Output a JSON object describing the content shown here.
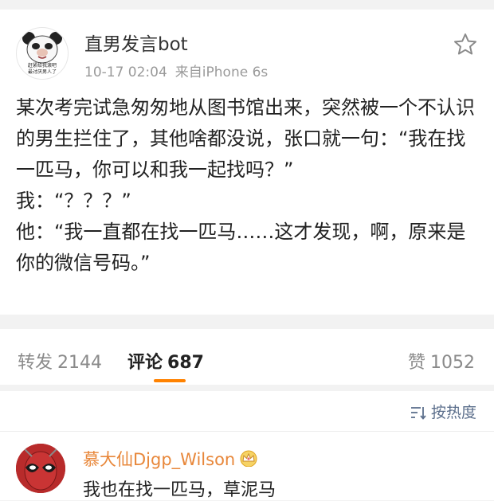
{
  "post": {
    "username": "直男发言bot",
    "time": "10-17 02:04",
    "source": "来自iPhone 6s",
    "avatar_caption_line1": "赶紧给我滚吧",
    "avatar_caption_line2": "最讨厌男人了",
    "lines": [
      "某次考完试急匆匆地从图书馆出来，突然被一个不认识的男生拦住了，其他啥都没说，张口就一句：“我在找一匹马，你可以和我一起找吗？”",
      "我：“？？？”",
      "他：“我一直都在找一匹马……这才发现，啊，原来是你的微信号码。”"
    ]
  },
  "stats": {
    "repost_label": "转发",
    "repost_count": "2144",
    "comment_label": "评论",
    "comment_count": "687",
    "like_label": "赞",
    "like_count": "1052"
  },
  "comments": {
    "sort_label": "按热度",
    "items": [
      {
        "username": "慕大仙Djgp_Wilson",
        "text": "我也在找一匹马，草泥马"
      }
    ]
  },
  "colors": {
    "accent_orange": "#ff8200",
    "commenter_name": "#e8873a",
    "sort_link": "#5c6f8c"
  }
}
